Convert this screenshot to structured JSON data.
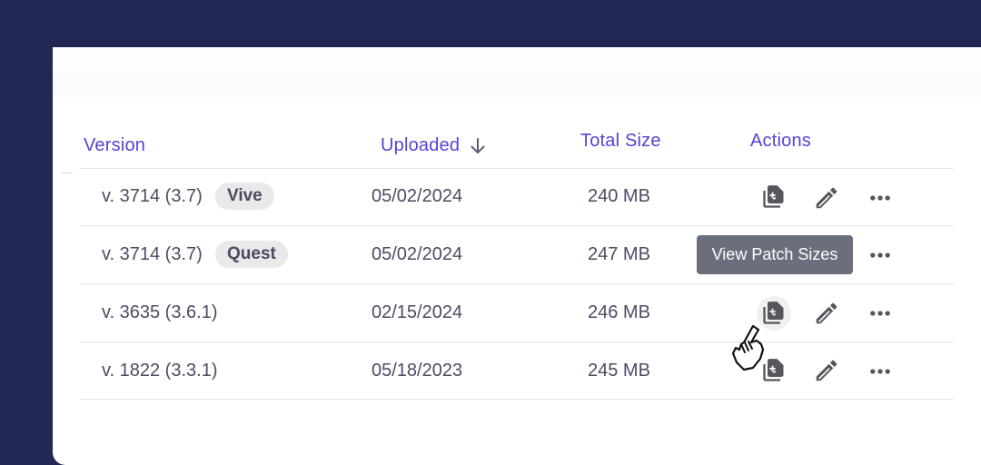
{
  "table": {
    "columns": [
      {
        "label": "Version"
      },
      {
        "label": "Uploaded",
        "sort": "descending"
      },
      {
        "label": "Total Size"
      },
      {
        "label": "Actions"
      }
    ],
    "rows": [
      {
        "version": "v. 3714 (3.7)",
        "badge": "Vive",
        "uploaded": "05/02/2024",
        "size": "240 MB"
      },
      {
        "version": "v. 3714 (3.7)",
        "badge": "Quest",
        "uploaded": "05/02/2024",
        "size": "247 MB"
      },
      {
        "version": "v. 3635 (3.6.1)",
        "badge": null,
        "uploaded": "02/15/2024",
        "size": "246 MB"
      },
      {
        "version": "v. 1822 (3.3.1)",
        "badge": null,
        "uploaded": "05/18/2023",
        "size": "245 MB"
      }
    ]
  },
  "tooltip": {
    "text": "View Patch Sizes"
  },
  "icons": {
    "patch_sizes": "file-diff-icon",
    "edit": "pencil-icon",
    "more": "more-horizontal-icon",
    "sort": "arrow-down-icon",
    "cursor": "hand-pointer-icon"
  },
  "colors": {
    "background": "#232852",
    "header_accent": "#5543d6",
    "tooltip_bg": "#6b6e7d"
  }
}
